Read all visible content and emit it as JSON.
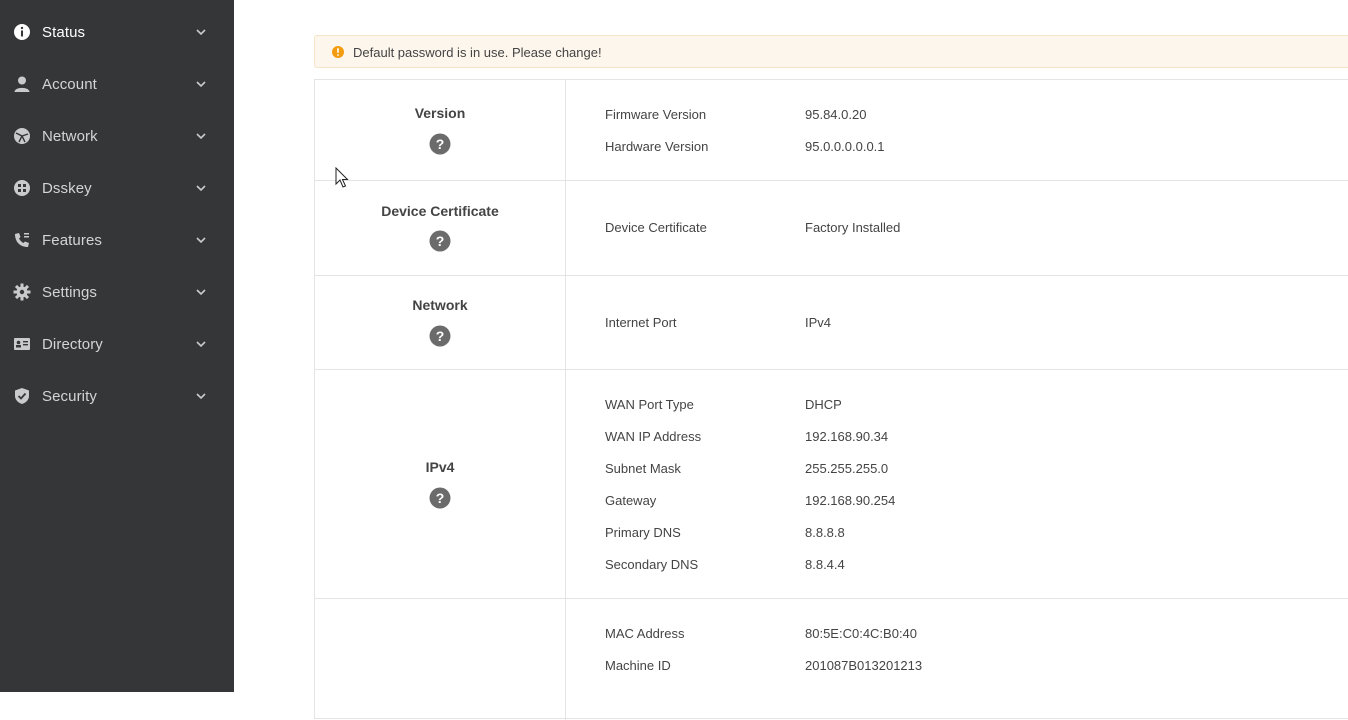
{
  "sidebar": {
    "items": [
      {
        "label": "Status",
        "icon": "info-icon"
      },
      {
        "label": "Account",
        "icon": "user-icon"
      },
      {
        "label": "Network",
        "icon": "globe-icon"
      },
      {
        "label": "Dsskey",
        "icon": "grid-icon"
      },
      {
        "label": "Features",
        "icon": "phone-icon"
      },
      {
        "label": "Settings",
        "icon": "gear-icon"
      },
      {
        "label": "Directory",
        "icon": "contact-card-icon"
      },
      {
        "label": "Security",
        "icon": "shield-icon"
      }
    ]
  },
  "warning": {
    "text": "Default password is in use. Please change!",
    "color": "#f39c12"
  },
  "sections": {
    "version": {
      "title": "Version",
      "rows": [
        {
          "label": "Firmware Version",
          "value": "95.84.0.20"
        },
        {
          "label": "Hardware Version",
          "value": "95.0.0.0.0.0.1"
        }
      ]
    },
    "certificate": {
      "title": "Device Certificate",
      "rows": [
        {
          "label": "Device Certificate",
          "value": "Factory Installed"
        }
      ]
    },
    "network": {
      "title": "Network",
      "rows": [
        {
          "label": "Internet Port",
          "value": "IPv4"
        }
      ]
    },
    "ipv4": {
      "title": "IPv4",
      "rows": [
        {
          "label": "WAN Port Type",
          "value": "DHCP"
        },
        {
          "label": "WAN IP Address",
          "value": "192.168.90.34"
        },
        {
          "label": "Subnet Mask",
          "value": "255.255.255.0"
        },
        {
          "label": "Gateway",
          "value": "192.168.90.254"
        },
        {
          "label": "Primary DNS",
          "value": "8.8.8.8"
        },
        {
          "label": "Secondary DNS",
          "value": "8.8.4.4"
        }
      ]
    },
    "device": {
      "rows": [
        {
          "label": "MAC Address",
          "value": "80:5E:C0:4C:B0:40"
        },
        {
          "label": "Machine ID",
          "value": "201087B013201213"
        }
      ]
    }
  },
  "colors": {
    "sidebar_bg": "#353638",
    "help_icon": "#6b6b6b",
    "warning_bg": "#fdf6ec"
  }
}
